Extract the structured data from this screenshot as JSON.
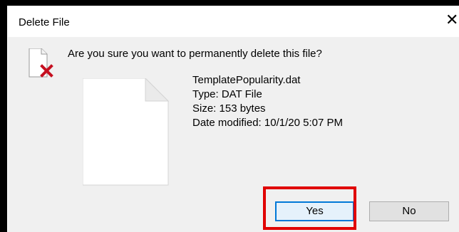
{
  "window": {
    "title": "Delete File",
    "close_glyph": "✕"
  },
  "dialog": {
    "question": "Are you sure you want to permanently delete this file?",
    "icon": "delete-file-warning-icon",
    "file": {
      "name": "TemplatePopularity.dat",
      "type": "Type: DAT File",
      "size": "Size: 153 bytes",
      "date_modified": "Date modified: 10/1/20 5:07 PM",
      "thumbnail_icon": "blank-document-icon"
    }
  },
  "buttons": {
    "yes_label": "Yes",
    "no_label": "No"
  },
  "colors": {
    "highlight": "#e00000",
    "focus_border": "#0078d7",
    "delete_x": "#c50f1f"
  }
}
